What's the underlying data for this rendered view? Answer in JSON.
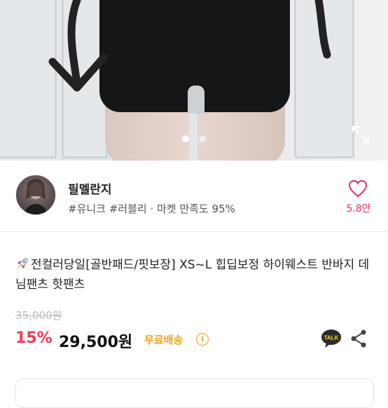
{
  "product": {
    "image_dots": 2,
    "active_dot": 0,
    "title_emoji": "rocket",
    "title": "전컬러당일[골반패드/핏보장] XS~L 힙딥보정 하이웨스트 반바지 데님팬츠 핫팬츠",
    "original_price": "35,000원",
    "discount": "15%",
    "price": "29,500원",
    "shipping_label": "무료배송"
  },
  "seller": {
    "name": "필멜란지",
    "tags": "#유니크 #러블리 · 마켓 만족도 95%",
    "like_count": "5.8만"
  },
  "icons": {
    "expand": "expand-icon",
    "like": "heart-icon",
    "talk": "kakaotalk-icon",
    "share": "share-icon",
    "info": "info-icon"
  },
  "colors": {
    "discount": "#f23c54",
    "like": "#e7315b",
    "shipping": "#f0a418"
  }
}
